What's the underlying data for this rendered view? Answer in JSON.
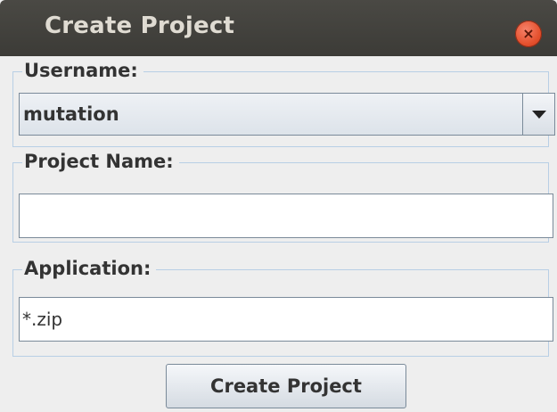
{
  "window": {
    "title": "Create Project",
    "close_glyph": "×"
  },
  "username": {
    "label": "Username:",
    "selected_value": "mutation"
  },
  "project_name": {
    "label": "Project Name:",
    "value": ""
  },
  "application": {
    "label": "Application:",
    "value": "*.zip"
  },
  "actions": {
    "create_label": "Create Project"
  },
  "colors": {
    "titlebar": "#3c3b37",
    "close_button": "#e4502d",
    "group_border": "#b8cfe5",
    "dialog_background": "#eeeeee"
  }
}
